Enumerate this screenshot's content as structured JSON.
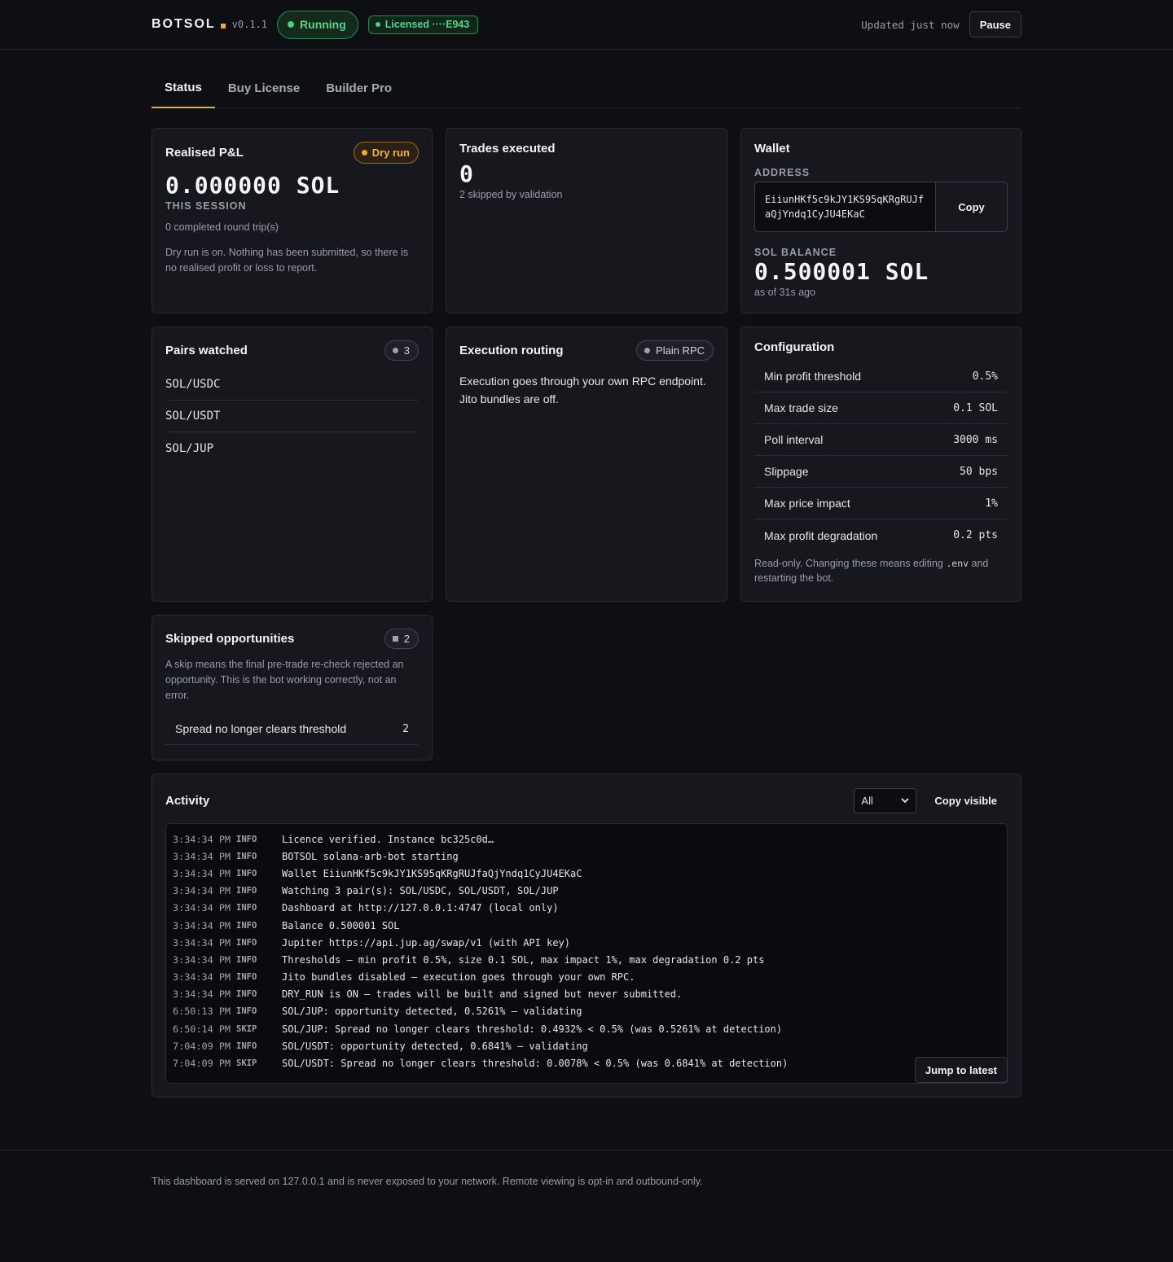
{
  "header": {
    "brand": "BOTSOL",
    "version": "v0.1.1",
    "status": "Running",
    "license": "Licensed ····E943",
    "updated": "Updated just now",
    "pause": "Pause"
  },
  "tabs": [
    "Status",
    "Buy License",
    "Builder Pro"
  ],
  "pnl": {
    "title": "Realised P&L",
    "badge": "Dry run",
    "value": "0.000000 SOL",
    "caption": "THIS SESSION",
    "round_trips": "0 completed round trip(s)",
    "note": "Dry run is on. Nothing has been submitted, so there is no realised profit or loss to report."
  },
  "trades": {
    "title": "Trades executed",
    "value": "0",
    "note": "2 skipped by validation"
  },
  "wallet": {
    "title": "Wallet",
    "address_label": "ADDRESS",
    "address_line1": "EiiunHKf5c9kJY1KS95qKRgRUJf",
    "address_line2": "aQjYndq1CyJU4EKaC",
    "copy": "Copy",
    "balance_label": "SOL BALANCE",
    "balance": "0.500001 SOL",
    "as_of": "as of 31s ago"
  },
  "pairs": {
    "title": "Pairs watched",
    "count": "3",
    "items": [
      "SOL/USDC",
      "SOL/USDT",
      "SOL/JUP"
    ]
  },
  "routing": {
    "title": "Execution routing",
    "badge": "Plain RPC",
    "text": "Execution goes through your own RPC endpoint. Jito bundles are off."
  },
  "config": {
    "title": "Configuration",
    "rows": [
      {
        "label": "Min profit threshold",
        "value": "0.5%"
      },
      {
        "label": "Max trade size",
        "value": "0.1 SOL"
      },
      {
        "label": "Poll interval",
        "value": "3000 ms"
      },
      {
        "label": "Slippage",
        "value": "50 bps"
      },
      {
        "label": "Max price impact",
        "value": "1%"
      },
      {
        "label": "Max profit degradation",
        "value": "0.2 pts"
      }
    ],
    "note_before": "Read-only. Changing these means editing ",
    "note_code": ".env",
    "note_after": " and restarting the bot."
  },
  "skipped": {
    "title": "Skipped opportunities",
    "count": "2",
    "note": "A skip means the final pre-trade re-check rejected an opportunity. This is the bot working correctly, not an error.",
    "rows": [
      {
        "label": "Spread no longer clears threshold",
        "value": "2"
      }
    ]
  },
  "activity": {
    "title": "Activity",
    "filter": "All",
    "copy_visible": "Copy visible",
    "jump": "Jump to latest",
    "lines": [
      {
        "time": "3:34:34 PM",
        "level": "INFO",
        "msg": "Licence verified. Instance bc325c0d…"
      },
      {
        "time": "3:34:34 PM",
        "level": "INFO",
        "msg": "BOTSOL solana-arb-bot starting"
      },
      {
        "time": "3:34:34 PM",
        "level": "INFO",
        "msg": "Wallet EiiunHKf5c9kJY1KS95qKRgRUJfaQjYndq1CyJU4EKaC"
      },
      {
        "time": "3:34:34 PM",
        "level": "INFO",
        "msg": "Watching 3 pair(s): SOL/USDC, SOL/USDT, SOL/JUP"
      },
      {
        "time": "3:34:34 PM",
        "level": "INFO",
        "msg": "Dashboard at http://127.0.0.1:4747 (local only)"
      },
      {
        "time": "3:34:34 PM",
        "level": "INFO",
        "msg": "Balance 0.500001 SOL"
      },
      {
        "time": "3:34:34 PM",
        "level": "INFO",
        "msg": "Jupiter https://api.jup.ag/swap/v1 (with API key)"
      },
      {
        "time": "3:34:34 PM",
        "level": "INFO",
        "msg": "Thresholds — min profit 0.5%, size 0.1 SOL, max impact 1%, max degradation 0.2 pts"
      },
      {
        "time": "3:34:34 PM",
        "level": "INFO",
        "msg": "Jito bundles disabled — execution goes through your own RPC."
      },
      {
        "time": "3:34:34 PM",
        "level": "INFO",
        "msg": "DRY_RUN is ON — trades will be built and signed but never submitted."
      },
      {
        "time": "6:50:13 PM",
        "level": "INFO",
        "msg": "SOL/JUP: opportunity detected, 0.5261% — validating"
      },
      {
        "time": "6:50:14 PM",
        "level": "SKIP",
        "msg": "SOL/JUP: Spread no longer clears threshold: 0.4932% < 0.5% (was 0.5261% at detection)"
      },
      {
        "time": "7:04:09 PM",
        "level": "INFO",
        "msg": "SOL/USDT: opportunity detected, 0.6841% — validating"
      },
      {
        "time": "7:04:09 PM",
        "level": "SKIP",
        "msg": "SOL/USDT: Spread no longer clears threshold: 0.0078% < 0.5% (was 0.6841% at detection)"
      }
    ]
  },
  "footer": "This dashboard is served on 127.0.0.1 and is never exposed to your network. Remote viewing is opt-in and outbound-only."
}
